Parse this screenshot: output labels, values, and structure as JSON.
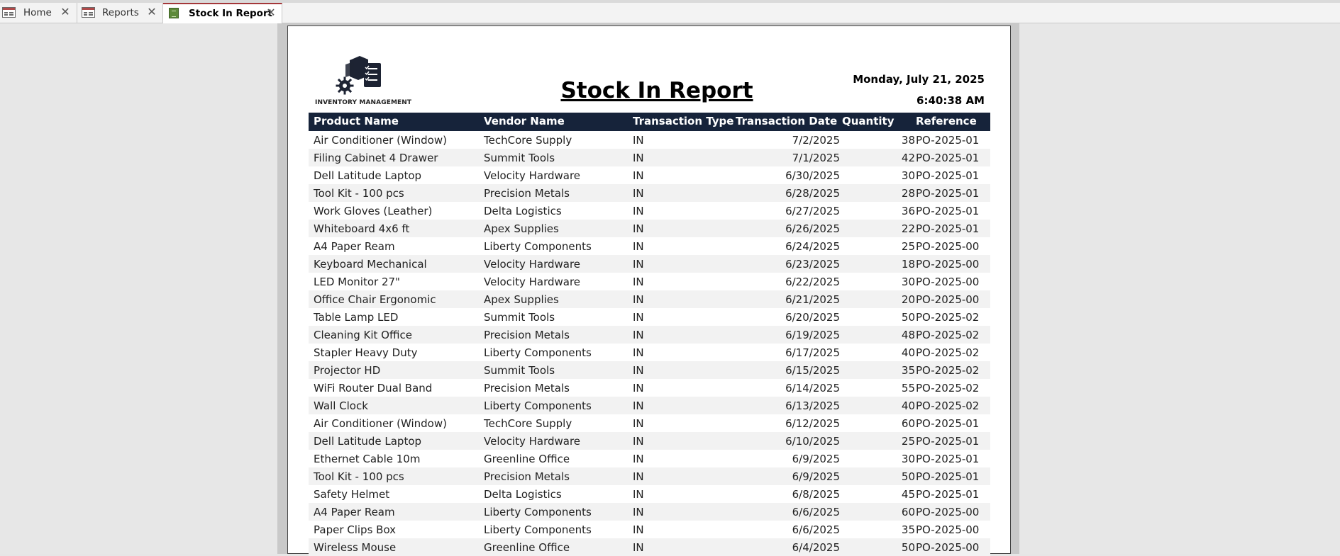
{
  "tabs": [
    {
      "label": "Home",
      "icon": "form-icon",
      "active": false
    },
    {
      "label": "Reports",
      "icon": "form-icon",
      "active": false
    },
    {
      "label": "Stock In Report",
      "icon": "report-icon",
      "active": true
    }
  ],
  "report": {
    "logo_text": "INVENTORY MANAGEMENT",
    "title": "Stock In Report",
    "date": "Monday, July 21, 2025",
    "time": "6:40:38 AM",
    "columns": [
      "Product Name",
      "Vendor Name",
      "Transaction Type",
      "Transaction Date",
      "Quantity",
      "Reference"
    ],
    "rows": [
      [
        "Air Conditioner (Window)",
        "TechCore Supply",
        "IN",
        "7/2/2025",
        "38",
        "PO-2025-01"
      ],
      [
        "Filing Cabinet 4 Drawer",
        "Summit Tools",
        "IN",
        "7/1/2025",
        "42",
        "PO-2025-01"
      ],
      [
        "Dell Latitude Laptop",
        "Velocity Hardware",
        "IN",
        "6/30/2025",
        "30",
        "PO-2025-01"
      ],
      [
        "Tool Kit - 100 pcs",
        "Precision Metals",
        "IN",
        "6/28/2025",
        "28",
        "PO-2025-01"
      ],
      [
        "Work Gloves (Leather)",
        "Delta Logistics",
        "IN",
        "6/27/2025",
        "36",
        "PO-2025-01"
      ],
      [
        "Whiteboard 4x6 ft",
        "Apex Supplies",
        "IN",
        "6/26/2025",
        "22",
        "PO-2025-01"
      ],
      [
        "A4 Paper Ream",
        "Liberty Components",
        "IN",
        "6/24/2025",
        "25",
        "PO-2025-00"
      ],
      [
        "Keyboard Mechanical",
        "Velocity Hardware",
        "IN",
        "6/23/2025",
        "18",
        "PO-2025-00"
      ],
      [
        "LED Monitor 27\"",
        "Velocity Hardware",
        "IN",
        "6/22/2025",
        "30",
        "PO-2025-00"
      ],
      [
        "Office Chair Ergonomic",
        "Apex Supplies",
        "IN",
        "6/21/2025",
        "20",
        "PO-2025-00"
      ],
      [
        "Table Lamp LED",
        "Summit Tools",
        "IN",
        "6/20/2025",
        "50",
        "PO-2025-02"
      ],
      [
        "Cleaning Kit Office",
        "Precision Metals",
        "IN",
        "6/19/2025",
        "48",
        "PO-2025-02"
      ],
      [
        "Stapler Heavy Duty",
        "Liberty Components",
        "IN",
        "6/17/2025",
        "40",
        "PO-2025-02"
      ],
      [
        "Projector HD",
        "Summit Tools",
        "IN",
        "6/15/2025",
        "35",
        "PO-2025-02"
      ],
      [
        "WiFi Router Dual Band",
        "Precision Metals",
        "IN",
        "6/14/2025",
        "55",
        "PO-2025-02"
      ],
      [
        "Wall Clock",
        "Liberty Components",
        "IN",
        "6/13/2025",
        "40",
        "PO-2025-02"
      ],
      [
        "Air Conditioner (Window)",
        "TechCore Supply",
        "IN",
        "6/12/2025",
        "60",
        "PO-2025-01"
      ],
      [
        "Dell Latitude Laptop",
        "Velocity Hardware",
        "IN",
        "6/10/2025",
        "25",
        "PO-2025-01"
      ],
      [
        "Ethernet Cable 10m",
        "Greenline Office",
        "IN",
        "6/9/2025",
        "30",
        "PO-2025-01"
      ],
      [
        "Tool Kit - 100 pcs",
        "Precision Metals",
        "IN",
        "6/9/2025",
        "50",
        "PO-2025-01"
      ],
      [
        "Safety Helmet",
        "Delta Logistics",
        "IN",
        "6/8/2025",
        "45",
        "PO-2025-01"
      ],
      [
        "A4 Paper Ream",
        "Liberty Components",
        "IN",
        "6/6/2025",
        "60",
        "PO-2025-00"
      ],
      [
        "Paper Clips Box",
        "Liberty Components",
        "IN",
        "6/6/2025",
        "35",
        "PO-2025-00"
      ],
      [
        "Wireless Mouse",
        "Greenline Office",
        "IN",
        "6/4/2025",
        "50",
        "PO-2025-00"
      ]
    ]
  },
  "colors": {
    "header_bg": "#16233a",
    "active_tab_accent": "#a4373a",
    "row_alt": "#f2f2f2"
  }
}
